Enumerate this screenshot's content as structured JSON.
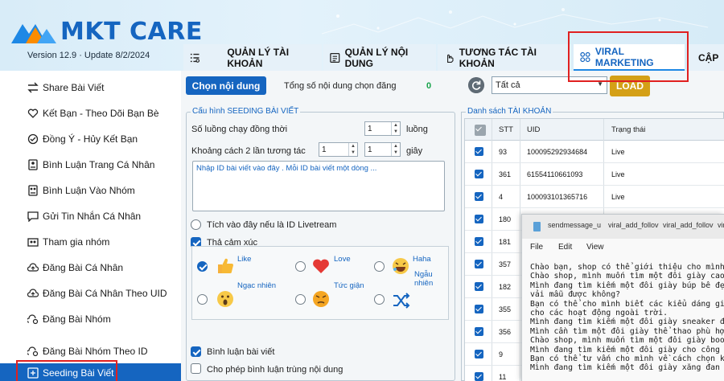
{
  "app": {
    "title": "MKT CARE",
    "version": "Version  12.9 · Update  8/2/2024"
  },
  "nav": {
    "tabs": [
      {
        "label": "QUẢN LÝ TÀI KHOẢN",
        "icon": "list-icon"
      },
      {
        "label": "QUẢN LÝ NỘI DUNG",
        "icon": "document-icon"
      },
      {
        "label": "TƯƠNG TÁC TÀI KHOẢN",
        "icon": "hand-pointer-icon"
      },
      {
        "label": "VIRAL MARKETING",
        "icon": "viral-icon",
        "active": true
      },
      {
        "label": "CẬP",
        "icon": "user-icon"
      }
    ]
  },
  "sidebar": {
    "items": [
      {
        "label": "Share Bài Viết",
        "icon": "share-arrows-icon"
      },
      {
        "label": "Kết Bạn - Theo Dõi Bạn Bè",
        "icon": "heart-add-icon"
      },
      {
        "label": "Đồng Ý - Hủy Kết Bạn",
        "icon": "check-circle-icon"
      },
      {
        "label": "Bình Luận Trang Cá Nhân",
        "icon": "profile-comment-icon"
      },
      {
        "label": "Bình Luận Vào Nhóm",
        "icon": "group-comment-icon"
      },
      {
        "label": "Gửi Tin Nhắn Cá Nhân",
        "icon": "message-icon"
      },
      {
        "label": "Tham gia nhóm",
        "icon": "join-group-icon"
      },
      {
        "label": "Đăng Bài Cá Nhân",
        "icon": "cloud-upload-icon"
      },
      {
        "label": "Đăng Bài Cá Nhân Theo UID",
        "icon": "cloud-upload-icon"
      },
      {
        "label": "Đăng Bài Nhóm",
        "icon": "group-post-icon"
      },
      {
        "label": "Đăng Bài Nhóm Theo ID",
        "icon": "group-post-icon"
      },
      {
        "label": "Seeding Bài Viết",
        "icon": "seeding-icon",
        "active": true
      }
    ]
  },
  "toolbar": {
    "choose_label": "Chọn nội dung",
    "total_label": "Tổng số nội dung chọn đăng",
    "total_value": "0",
    "filter_value": "Tất cả",
    "load_label": "LOAD"
  },
  "config": {
    "legend": "Cấu hình SEEDING BÀI VIẾT",
    "threads_label": "Số luồng chạy đồng thời",
    "threads_value": "1",
    "threads_unit": "luồng",
    "interval_label": "Khoảng cách 2 lần tương tác",
    "interval_from": "1",
    "interval_to": "1",
    "interval_unit": "giây",
    "ids_placeholder": "Nhập ID bài viết vào đây . Mỗi ID bài viết một dòng ...",
    "livestream_label": "Tích vào đây nếu là ID Livetream",
    "livestream_checked": false,
    "react_label": "Thả cảm xúc",
    "react_checked": true,
    "emotions": [
      {
        "label": "Like",
        "checked": true,
        "icon": "like-icon"
      },
      {
        "label": "Love",
        "checked": false,
        "icon": "love-icon"
      },
      {
        "label": "Haha",
        "checked": false,
        "icon": "haha-icon"
      },
      {
        "label": "Ngạc nhiên",
        "checked": false,
        "icon": "wow-icon"
      },
      {
        "label": "Tức giận",
        "checked": false,
        "icon": "angry-icon"
      },
      {
        "label": "Ngẫu nhiên",
        "checked": false,
        "icon": "shuffle-icon"
      }
    ],
    "comment_label": "Bình luận bài viết",
    "comment_checked": true,
    "duplicate_label": "Cho phép bình luận trùng nội dung",
    "duplicate_checked": false
  },
  "accounts": {
    "legend": "Danh sách TÀI KHOẢN",
    "columns": [
      "STT",
      "UID",
      "Trạng thái"
    ],
    "rows": [
      {
        "stt": "93",
        "uid": "100095292934684",
        "status": "Live"
      },
      {
        "stt": "361",
        "uid": "61554110661093",
        "status": "Live"
      },
      {
        "stt": "4",
        "uid": "100093101365716",
        "status": "Live"
      },
      {
        "stt": "180",
        "uid": "",
        "status": ""
      },
      {
        "stt": "181",
        "uid": "",
        "status": ""
      },
      {
        "stt": "357",
        "uid": "",
        "status": ""
      },
      {
        "stt": "182",
        "uid": "",
        "status": ""
      },
      {
        "stt": "355",
        "uid": "",
        "status": ""
      },
      {
        "stt": "356",
        "uid": "",
        "status": ""
      },
      {
        "stt": "9",
        "uid": "",
        "status": ""
      },
      {
        "stt": "11",
        "uid": "",
        "status": ""
      }
    ]
  },
  "notepad": {
    "tabs": [
      "sendmessage_u",
      "viral_add_follov",
      "viral_add_follov",
      "vira"
    ],
    "menu": [
      "File",
      "Edit",
      "View"
    ],
    "lines": [
      "Chào bạn, shop có thể giới thiệu cho mình m",
      "Chào shop, mình muốn tìm một đôi giày cao g",
      "Mình đang tìm kiếm một đôi giày búp bê đẹp ",
      "vải mẫu được không?",
      "Bạn có thể cho mình biết các kiểu dáng giày",
      "cho các hoạt động ngoài trời.",
      "Mình đang tìm kiếm một đôi giày sneaker để ",
      "Mình cần tìm một đôi giày thể thao phù hợp ",
      "Chào shop, mình muốn tìm một đôi giày boots",
      "Mình đang tìm kiếm một đôi giày cho công vi",
      "Bạn có thể tư vấn cho mình về cách chọn kíc",
      "Mình đang tìm kiếm một đôi giày xăng đan đe"
    ]
  },
  "colors": {
    "brand": "#1565c0",
    "highlight": "#e02020",
    "load": "#d4a017",
    "count": "#16a34a"
  }
}
